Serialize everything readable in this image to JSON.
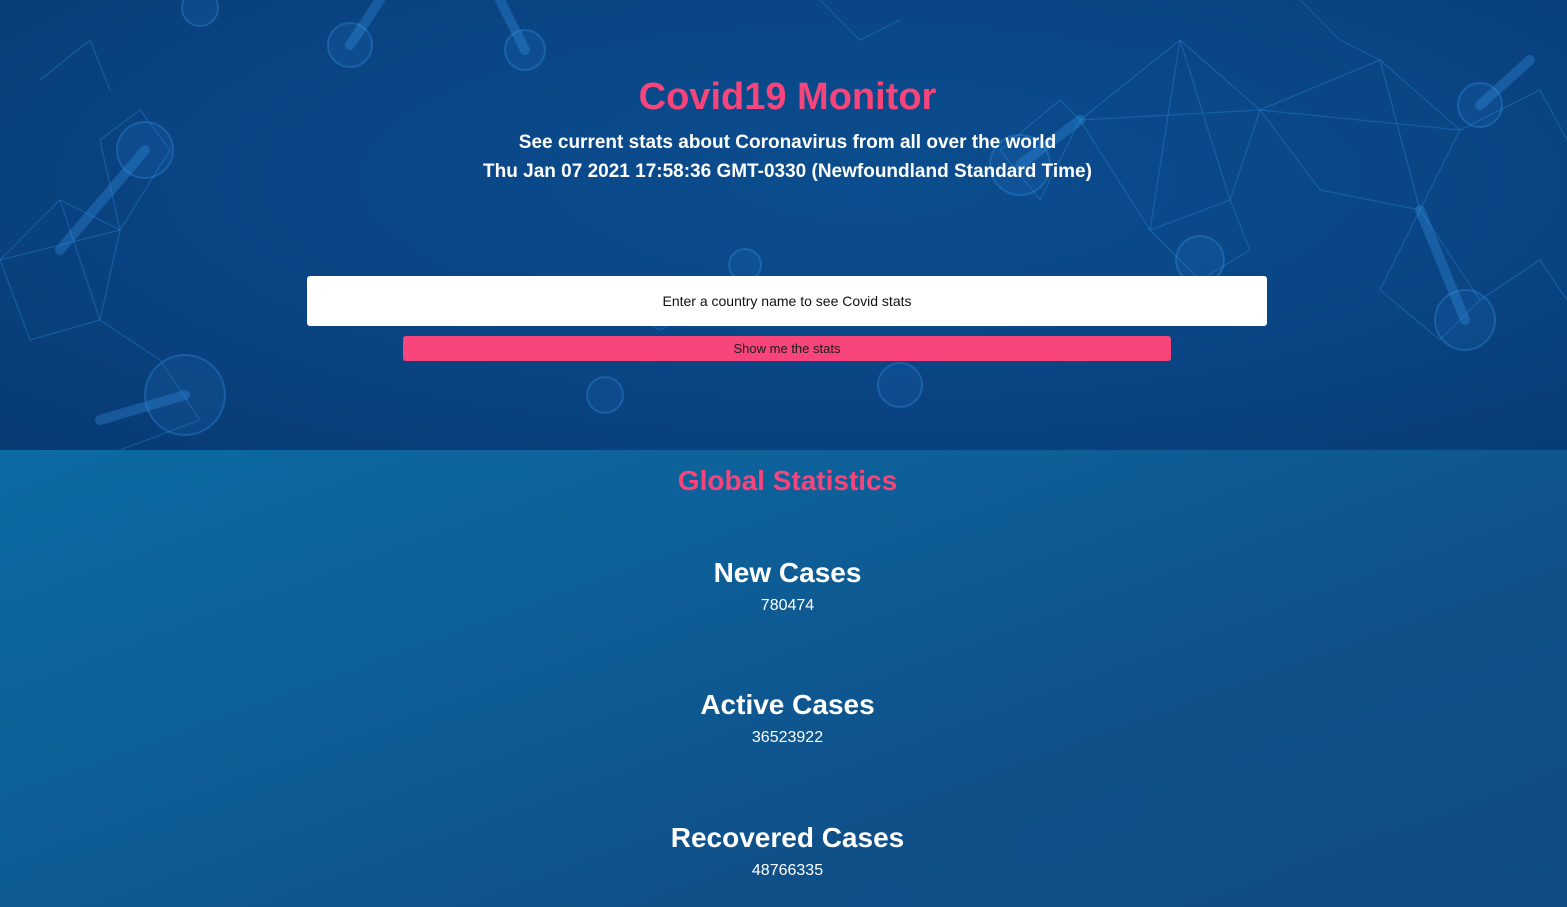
{
  "header": {
    "title": "Covid19 Monitor",
    "subtitle": "See current stats about Coronavirus from all over the world",
    "datetime": "Thu Jan 07 2021 17:58:36 GMT-0330 (Newfoundland Standard Time)"
  },
  "search": {
    "placeholder": "Enter a country name to see Covid stats",
    "value": ""
  },
  "button": {
    "label": "Show me the stats"
  },
  "global": {
    "title": "Global Statistics",
    "stats": [
      {
        "label": "New Cases",
        "value": "780474"
      },
      {
        "label": "Active Cases",
        "value": "36523922"
      },
      {
        "label": "Recovered Cases",
        "value": "48766335"
      }
    ]
  },
  "colors": {
    "accent": "#f7457c",
    "hero_bg": "#0a4686",
    "stats_bg": "#0e5f98"
  }
}
